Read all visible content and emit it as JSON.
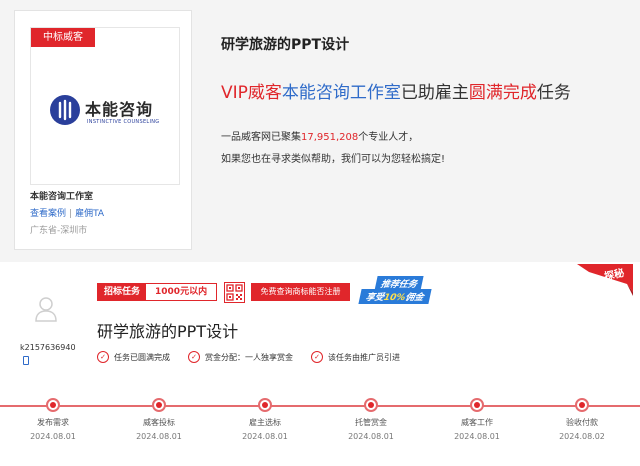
{
  "studio": {
    "tag": "中标威客",
    "logo_name": "本能咨询",
    "logo_subtitle": "INSTINCTIVE COUNSELING",
    "name": "本能咨询工作室",
    "link_cases": "查看案例",
    "link_separator": "|",
    "link_hire": "雇佣TA",
    "location": "广东省-深圳市"
  },
  "summary": {
    "project_title": "研学旅游的PPT设计",
    "headline_part1": "VIP威客",
    "headline_part2": "本能咨询工作室",
    "headline_part3": "已助雇主",
    "headline_part4": "圆满完成",
    "headline_part5": "任务",
    "stats_prefix": "一品威客网已聚集",
    "stats_number": "17,951,208",
    "stats_suffix": "个专业人才，",
    "helpline": "如果您也在寻求类似帮助，我们可以为您轻松搞定!"
  },
  "task": {
    "username": "k2157636940",
    "bid_label": "招标任务",
    "bid_value": "1000元以内",
    "trademark_button": "免费查询商标能否注册",
    "promo_line1": "推荐任务",
    "promo_line2_prefix": "享受",
    "promo_line2_highlight": "10%",
    "promo_line2_suffix": "佣金",
    "ribbon": "探秘",
    "title": "研学旅游的PPT设计",
    "tags": [
      {
        "label": "任务已圆满完成"
      },
      {
        "label": "赏金分配：一人独享赏金"
      },
      {
        "label": "该任务由推广员引进"
      }
    ]
  },
  "timeline": [
    {
      "label": "发布需求",
      "date": "2024.08.01"
    },
    {
      "label": "威客投标",
      "date": "2024.08.01"
    },
    {
      "label": "雇主选标",
      "date": "2024.08.01"
    },
    {
      "label": "托管赏金",
      "date": "2024.08.01"
    },
    {
      "label": "威客工作",
      "date": "2024.08.01"
    },
    {
      "label": "验收付款",
      "date": "2024.08.02"
    }
  ],
  "colors": {
    "accent": "#e0262b",
    "link": "#2f6bc9",
    "logo": "#2a3f9b"
  }
}
